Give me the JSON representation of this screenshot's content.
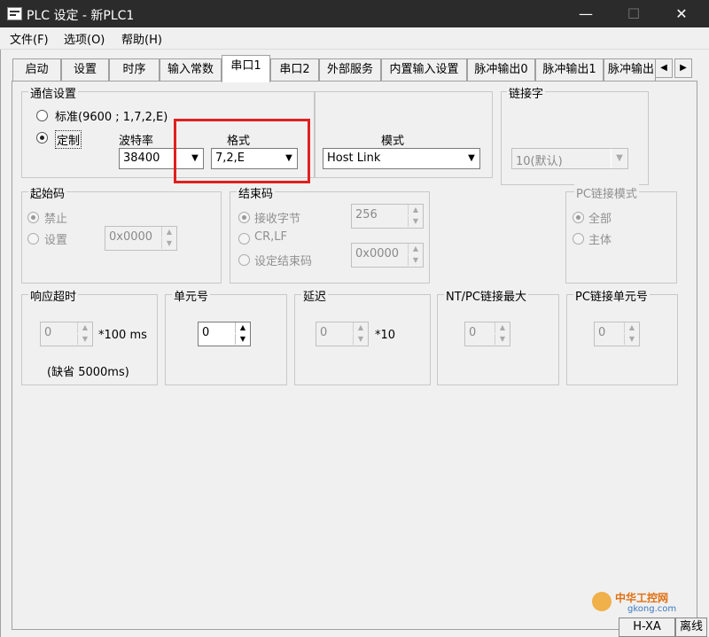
{
  "window": {
    "title": "PLC 设定 - 新PLC1",
    "minimize": "—",
    "maximize": "☐",
    "close": "✕"
  },
  "menu": [
    "文件(F)",
    "选项(O)",
    "帮助(H)"
  ],
  "tabs": [
    "启动",
    "设置",
    "时序",
    "输入常数",
    "串口1",
    "串口2",
    "外部服务",
    "内置输入设置",
    "脉冲输出0",
    "脉冲输出1",
    "脉冲输出"
  ],
  "active_tab": "串口1",
  "comm": {
    "group_label": "通信设置",
    "standard_label": "标准(9600 ; 1,7,2,E)",
    "custom_label": "定制",
    "baud_label": "波特率",
    "baud_value": "38400",
    "format_label": "格式",
    "format_value": "7,2,E",
    "mode_label": "模式",
    "mode_value": "Host Link"
  },
  "link": {
    "group_label": "链接字",
    "value": "10(默认)"
  },
  "start_code": {
    "group_label": "起始码",
    "disable": "禁止",
    "set": "设置",
    "value": "0x0000"
  },
  "end_code": {
    "group_label": "结束码",
    "recv_bytes": "接收字节",
    "crlf": "CR,LF",
    "set_end": "设定结束码",
    "bytes_value": "256",
    "code_value": "0x0000"
  },
  "pc_link_mode": {
    "group_label": "PC链接模式",
    "all": "全部",
    "master": "主体"
  },
  "response_timeout": {
    "group_label": "响应超时",
    "value": "0",
    "unit": "*100 ms",
    "default_note": "(缺省 5000ms)"
  },
  "unit_no": {
    "group_label": "单元号",
    "value": "0"
  },
  "delay": {
    "group_label": "延迟",
    "value": "0",
    "unit": "*10"
  },
  "nt_pc_max": {
    "group_label": "NT/PC链接最大",
    "value": "0"
  },
  "pc_link_unit": {
    "group_label": "PC链接单元号",
    "value": "0"
  },
  "watermark": {
    "line1": "中华工控网",
    "line2": "gkong.com"
  },
  "status": [
    "H-XA",
    "离线"
  ],
  "colors": {
    "highlight": "#e02020",
    "titlebar": "#2b2b2b"
  }
}
